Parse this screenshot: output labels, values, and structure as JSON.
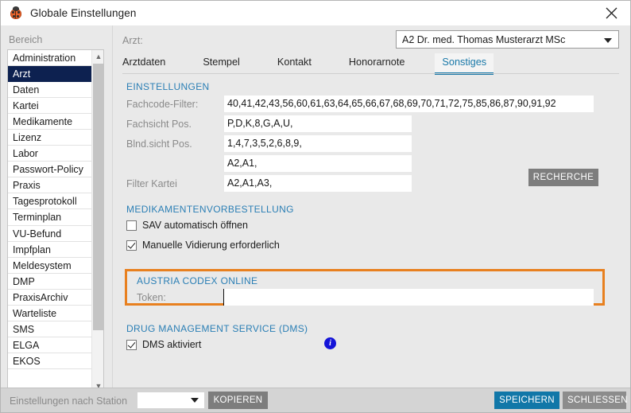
{
  "window": {
    "title": "Globale Einstellungen",
    "app_icon": "ladybug-icon",
    "close_icon": "close-icon"
  },
  "sidebar": {
    "label": "Bereich",
    "selected": "Arzt",
    "items": [
      {
        "label": "Administration"
      },
      {
        "label": "Arzt"
      },
      {
        "label": "Daten"
      },
      {
        "label": "Kartei"
      },
      {
        "label": "Medikamente"
      },
      {
        "label": "Lizenz"
      },
      {
        "label": "Labor"
      },
      {
        "label": "Passwort-Policy"
      },
      {
        "label": "Praxis"
      },
      {
        "label": "Tagesprotokoll"
      },
      {
        "label": "Terminplan"
      },
      {
        "label": "VU-Befund"
      },
      {
        "label": "Impfplan"
      },
      {
        "label": "Meldesystem"
      },
      {
        "label": "DMP"
      },
      {
        "label": "PraxisArchiv"
      },
      {
        "label": "Warteliste"
      },
      {
        "label": "SMS"
      },
      {
        "label": "ELGA"
      },
      {
        "label": "EKOS"
      }
    ],
    "scroll_up_icon": "chevron-up-icon",
    "scroll_down_icon": "chevron-down-icon"
  },
  "main": {
    "arzt_label": "Arzt:",
    "arzt_selected": "A2 Dr. med. Thomas Musterarzt MSc",
    "arzt_dropdown_icon": "chevron-down-icon",
    "tabs": [
      {
        "label": "Arztdaten",
        "active": false
      },
      {
        "label": "Stempel",
        "active": false
      },
      {
        "label": "Kontakt",
        "active": false
      },
      {
        "label": "Honorarnote",
        "active": false
      },
      {
        "label": "Sonstiges",
        "active": true
      }
    ],
    "einstellungen": {
      "heading": "EINSTELLUNGEN",
      "fields": [
        {
          "label": "Fachcode-Filter:",
          "value": "40,41,42,43,56,60,61,63,64,65,66,67,68,69,70,71,72,75,85,86,87,90,91,92"
        },
        {
          "label": "Fachsicht Pos.",
          "value": "P,D,K,8,G,A,U,"
        },
        {
          "label": "Blnd.sicht Pos.",
          "value": "1,4,7,3,5,2,6,8,9,"
        },
        {
          "label": "",
          "value": "A2,A1,"
        },
        {
          "label": "Filter Kartei",
          "value": "A2,A1,A3,"
        }
      ],
      "recherche_button": "RECHERCHE"
    },
    "medikamentenvorbestellung": {
      "heading": "MEDIKAMENTENVORBESTELLUNG",
      "checkboxes": [
        {
          "label": "SAV automatisch öffnen",
          "checked": false
        },
        {
          "label": "Manuelle Vidierung erforderlich",
          "checked": true
        }
      ]
    },
    "austria_codex": {
      "heading": "AUSTRIA CODEX ONLINE",
      "token_label": "Token:",
      "token_value": "",
      "highlight_color": "#e8801f"
    },
    "dms": {
      "heading": "DRUG MANAGEMENT SERVICE (DMS)",
      "checkbox": {
        "label": "DMS aktiviert",
        "checked": true
      },
      "info_icon": "info-icon"
    },
    "help_button": "?"
  },
  "footer": {
    "station_label": "Einstellungen nach Station",
    "station_value": "",
    "station_dropdown_icon": "chevron-down-icon",
    "kopieren_button": "KOPIEREN",
    "speichern_button": "SPEICHERN",
    "schliessen_button": "SCHLIESSEN",
    "accent_color": "#1177a8"
  }
}
